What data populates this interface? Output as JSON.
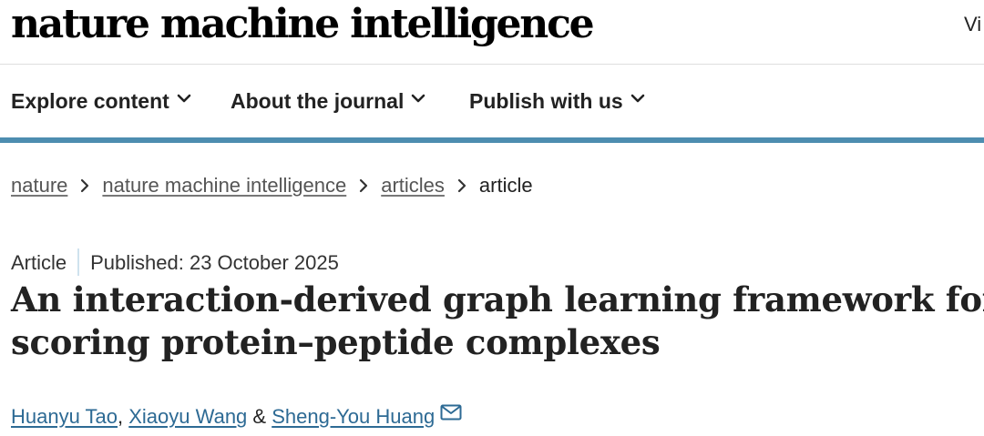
{
  "header": {
    "logo_text": "nature machine intelligence",
    "top_right_link": "Vi"
  },
  "nav": {
    "items": [
      {
        "label": "Explore content",
        "icon": "chevron-down-icon"
      },
      {
        "label": "About the journal",
        "icon": "chevron-down-icon"
      },
      {
        "label": "Publish with us",
        "icon": "chevron-down-icon"
      }
    ],
    "accent_color": "#4d8db0"
  },
  "breadcrumb": {
    "items": [
      "nature",
      "nature machine intelligence",
      "articles"
    ],
    "current": "article",
    "separator_icon": "chevron-right-icon"
  },
  "article": {
    "type": "Article",
    "published": "Published: 23 October 2025",
    "title_line1": "An interaction-derived graph learning framework for",
    "title_line2": "scoring protein–peptide complexes",
    "authors": [
      "Huanyu Tao",
      "Xiaoyu Wang",
      "Sheng-You Huang"
    ],
    "author_separator": ", ",
    "author_conjunction": " & ",
    "contact_icon": "envelope-icon"
  }
}
